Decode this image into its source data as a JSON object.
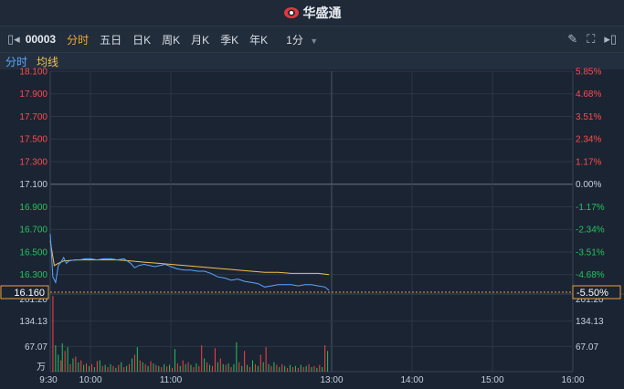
{
  "header": {
    "brand": "华盛通"
  },
  "toolbar": {
    "code": "00003",
    "tabs": [
      "分时",
      "五日",
      "日K",
      "周K",
      "月K",
      "季K",
      "年K"
    ],
    "active_tab": "分时",
    "interval": "1分"
  },
  "subtabs": {
    "time": "分时",
    "avg": "均线"
  },
  "colors": {
    "price": "#5aa7ff",
    "avg": "#f2c14e",
    "up": "#ff4040",
    "down": "#22c55e",
    "bg": "#1b2433"
  },
  "chart_data": {
    "type": "line",
    "base_price": 17.1,
    "current_price": "16.160",
    "current_pct": "-5.50%",
    "ylim": [
      16.16,
      18.1
    ],
    "price_ticks": [
      "18.100",
      "17.900",
      "17.700",
      "17.500",
      "17.300",
      "17.100",
      "16.900",
      "16.700",
      "16.500",
      "16.300"
    ],
    "pct_ticks": [
      "5.85%",
      "4.68%",
      "3.51%",
      "2.34%",
      "1.17%",
      "0.00%",
      "-1.17%",
      "-2.34%",
      "-3.51%",
      "-4.68%"
    ],
    "time_ticks": [
      "9:30",
      "10:00",
      "11:00",
      "13:00",
      "14:00",
      "15:00",
      "16:00"
    ],
    "volume_ticks": [
      "201.20",
      "134.13",
      "67.07"
    ],
    "volume_unit": "万",
    "series": [
      {
        "points": [
          [
            0,
            16.66
          ],
          [
            2,
            16.28
          ],
          [
            4,
            16.23
          ],
          [
            6,
            16.38
          ],
          [
            8,
            16.41
          ],
          [
            10,
            16.45
          ],
          [
            12,
            16.4
          ],
          [
            14,
            16.42
          ],
          [
            18,
            16.43
          ],
          [
            22,
            16.43
          ],
          [
            26,
            16.44
          ],
          [
            30,
            16.44
          ],
          [
            35,
            16.43
          ],
          [
            40,
            16.44
          ],
          [
            45,
            16.44
          ],
          [
            50,
            16.43
          ],
          [
            55,
            16.44
          ],
          [
            60,
            16.4
          ],
          [
            63,
            16.36
          ],
          [
            66,
            16.38
          ],
          [
            70,
            16.39
          ],
          [
            74,
            16.38
          ],
          [
            78,
            16.37
          ],
          [
            82,
            16.38
          ],
          [
            86,
            16.39
          ],
          [
            90,
            16.37
          ],
          [
            95,
            16.35
          ],
          [
            100,
            16.34
          ],
          [
            105,
            16.34
          ],
          [
            110,
            16.33
          ],
          [
            115,
            16.33
          ],
          [
            120,
            16.31
          ],
          [
            125,
            16.28
          ],
          [
            130,
            16.27
          ],
          [
            135,
            16.25
          ],
          [
            140,
            16.26
          ],
          [
            145,
            16.24
          ],
          [
            150,
            16.23
          ],
          [
            155,
            16.22
          ],
          [
            160,
            16.19
          ],
          [
            165,
            16.2
          ],
          [
            170,
            16.21
          ],
          [
            175,
            16.21
          ],
          [
            180,
            16.21
          ],
          [
            185,
            16.2
          ],
          [
            190,
            16.21
          ],
          [
            195,
            16.21
          ],
          [
            200,
            16.2
          ],
          [
            205,
            16.19
          ],
          [
            208,
            16.16
          ]
        ]
      },
      {
        "points": [
          [
            0,
            16.6
          ],
          [
            3,
            16.38
          ],
          [
            6,
            16.4
          ],
          [
            10,
            16.42
          ],
          [
            20,
            16.43
          ],
          [
            30,
            16.43
          ],
          [
            40,
            16.43
          ],
          [
            50,
            16.43
          ],
          [
            60,
            16.42
          ],
          [
            70,
            16.41
          ],
          [
            80,
            16.4
          ],
          [
            90,
            16.39
          ],
          [
            100,
            16.38
          ],
          [
            110,
            16.37
          ],
          [
            120,
            16.36
          ],
          [
            130,
            16.35
          ],
          [
            140,
            16.34
          ],
          [
            150,
            16.33
          ],
          [
            160,
            16.32
          ],
          [
            170,
            16.32
          ],
          [
            180,
            16.31
          ],
          [
            190,
            16.31
          ],
          [
            200,
            16.31
          ],
          [
            208,
            16.3
          ]
        ]
      }
    ],
    "volumes": [
      [
        2,
        201,
        1
      ],
      [
        4,
        70,
        0
      ],
      [
        6,
        45,
        0
      ],
      [
        8,
        30,
        1
      ],
      [
        9,
        75,
        0
      ],
      [
        11,
        55,
        1
      ],
      [
        13,
        65,
        0
      ],
      [
        15,
        20,
        1
      ],
      [
        17,
        35,
        0
      ],
      [
        19,
        40,
        1
      ],
      [
        21,
        25,
        0
      ],
      [
        23,
        30,
        1
      ],
      [
        25,
        18,
        0
      ],
      [
        27,
        22,
        1
      ],
      [
        29,
        15,
        0
      ],
      [
        31,
        20,
        1
      ],
      [
        33,
        12,
        0
      ],
      [
        35,
        28,
        1
      ],
      [
        37,
        30,
        0
      ],
      [
        39,
        15,
        1
      ],
      [
        41,
        18,
        0
      ],
      [
        43,
        12,
        1
      ],
      [
        45,
        20,
        0
      ],
      [
        47,
        15,
        1
      ],
      [
        49,
        10,
        0
      ],
      [
        51,
        18,
        1
      ],
      [
        53,
        25,
        0
      ],
      [
        55,
        12,
        1
      ],
      [
        57,
        15,
        0
      ],
      [
        59,
        20,
        1
      ],
      [
        61,
        35,
        0
      ],
      [
        63,
        45,
        1
      ],
      [
        65,
        65,
        0
      ],
      [
        67,
        30,
        1
      ],
      [
        69,
        25,
        0
      ],
      [
        71,
        20,
        1
      ],
      [
        73,
        15,
        0
      ],
      [
        75,
        28,
        1
      ],
      [
        77,
        22,
        0
      ],
      [
        79,
        18,
        1
      ],
      [
        81,
        15,
        0
      ],
      [
        83,
        12,
        1
      ],
      [
        85,
        20,
        0
      ],
      [
        87,
        14,
        1
      ],
      [
        89,
        18,
        0
      ],
      [
        91,
        10,
        1
      ],
      [
        93,
        60,
        0
      ],
      [
        95,
        22,
        1
      ],
      [
        97,
        15,
        0
      ],
      [
        99,
        30,
        1
      ],
      [
        101,
        20,
        0
      ],
      [
        103,
        25,
        1
      ],
      [
        105,
        18,
        0
      ],
      [
        107,
        12,
        1
      ],
      [
        109,
        22,
        0
      ],
      [
        111,
        15,
        1
      ],
      [
        113,
        70,
        1
      ],
      [
        115,
        35,
        0
      ],
      [
        117,
        25,
        1
      ],
      [
        119,
        18,
        0
      ],
      [
        121,
        15,
        1
      ],
      [
        123,
        62,
        1
      ],
      [
        125,
        25,
        0
      ],
      [
        127,
        35,
        1
      ],
      [
        129,
        20,
        0
      ],
      [
        131,
        18,
        1
      ],
      [
        133,
        22,
        0
      ],
      [
        135,
        12,
        1
      ],
      [
        137,
        20,
        0
      ],
      [
        139,
        78,
        0
      ],
      [
        141,
        25,
        1
      ],
      [
        143,
        15,
        0
      ],
      [
        145,
        55,
        1
      ],
      [
        147,
        18,
        0
      ],
      [
        149,
        12,
        1
      ],
      [
        151,
        30,
        0
      ],
      [
        153,
        20,
        1
      ],
      [
        155,
        15,
        0
      ],
      [
        157,
        45,
        1
      ],
      [
        159,
        25,
        0
      ],
      [
        161,
        65,
        1
      ],
      [
        163,
        20,
        0
      ],
      [
        165,
        15,
        1
      ],
      [
        167,
        25,
        0
      ],
      [
        169,
        18,
        1
      ],
      [
        171,
        12,
        0
      ],
      [
        173,
        20,
        1
      ],
      [
        175,
        15,
        0
      ],
      [
        177,
        10,
        1
      ],
      [
        179,
        18,
        0
      ],
      [
        181,
        12,
        1
      ],
      [
        183,
        15,
        0
      ],
      [
        185,
        10,
        1
      ],
      [
        187,
        18,
        0
      ],
      [
        189,
        12,
        1
      ],
      [
        191,
        15,
        0
      ],
      [
        193,
        20,
        1
      ],
      [
        195,
        12,
        0
      ],
      [
        197,
        15,
        1
      ],
      [
        199,
        10,
        0
      ],
      [
        201,
        18,
        1
      ],
      [
        203,
        12,
        0
      ],
      [
        205,
        70,
        1
      ],
      [
        207,
        55,
        0
      ]
    ]
  }
}
